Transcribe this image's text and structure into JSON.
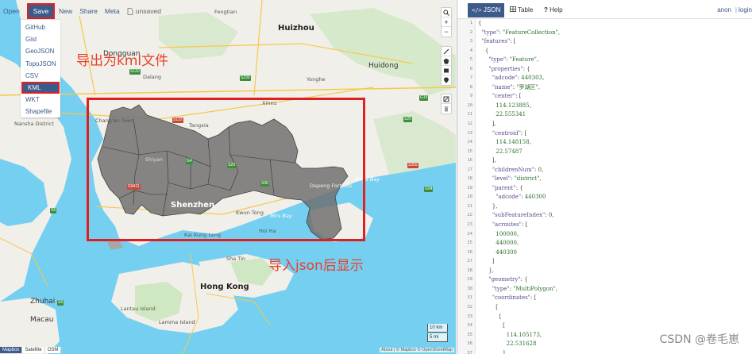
{
  "topbar": {
    "open": "Open",
    "save": "Save",
    "new": "New",
    "share": "Share",
    "meta": "Meta",
    "unsaved": "unsaved"
  },
  "save_menu": [
    "GitHub",
    "Gist",
    "GeoJSON",
    "TopoJSON",
    "CSV",
    "KML",
    "WKT",
    "Shapefile"
  ],
  "annotations": {
    "export_kml": "导出为kml文件",
    "import_json": "导入json后显示"
  },
  "map_labels": {
    "cities": [
      "Huizhou",
      "Dongguan",
      "Shenzhen",
      "Hong Kong",
      "Zhuhai",
      "Macau",
      "Huidong"
    ],
    "towns": [
      "Chang'an Town",
      "Shiyan",
      "Tangxia",
      "Xinxu",
      "Dalang",
      "Kwun Tong",
      "Nansha District",
      "Dapeng Fortress",
      "Lantau Island",
      "Sha Tin",
      "Kai Kung Leng",
      "Hoi Ha",
      "Daya Bay",
      "Mirs Bay",
      "Fengtian",
      "Yonghe",
      "Lamma Island"
    ],
    "roads": [
      "S122",
      "S120",
      "G15",
      "S30",
      "S239",
      "G4",
      "S29",
      "G9411",
      "S20",
      "S6",
      "S359",
      "G94",
      "S6"
    ]
  },
  "map_controls": {
    "zoom_in": "+",
    "zoom_out": "−",
    "scale_km": "10 km",
    "scale_mi": "5 mi",
    "attribution": "About | © Mapbox © OpenStreetMap",
    "layers": [
      "Mapbox",
      "Satellite",
      "OSM"
    ]
  },
  "panel": {
    "tabs": [
      "JSON",
      "Table",
      "Help"
    ],
    "user": "anon",
    "sep": "|",
    "login": "login"
  },
  "code_lines": [
    "{",
    "  \"type\": \"FeatureCollection\",",
    "  \"features\": [",
    "    {",
    "      \"type\": \"Feature\",",
    "      \"properties\": {",
    "        \"adcode\": 440303,",
    "        \"name\": \"罗湖区\",",
    "        \"center\": [",
    "          114.123885,",
    "          22.555341",
    "        ],",
    "        \"centroid\": [",
    "          114.148158,",
    "          22.57487",
    "        ],",
    "        \"childrenNum\": 0,",
    "        \"level\": \"district\",",
    "        \"parent\": {",
    "          \"adcode\": 440300",
    "        },",
    "        \"subFeatureIndex\": 0,",
    "        \"acroutes\": [",
    "          100000,",
    "          440000,",
    "          440300",
    "        ]",
    "      },",
    "      \"geometry\": {",
    "        \"type\": \"MultiPolygon\",",
    "        \"coordinates\": [",
    "          [",
    "            [",
    "              [",
    "                114.105173,",
    "                22.531628",
    "              ],"
  ],
  "watermark": "CSDN @卷毛崽",
  "colors": {
    "accent": "#3c5b8a",
    "annotation": "#e8402c",
    "highlight_border": "#e02020",
    "water": "#75cff0",
    "land": "#f1efe9",
    "polygon_fill": "#6d6d6d"
  }
}
